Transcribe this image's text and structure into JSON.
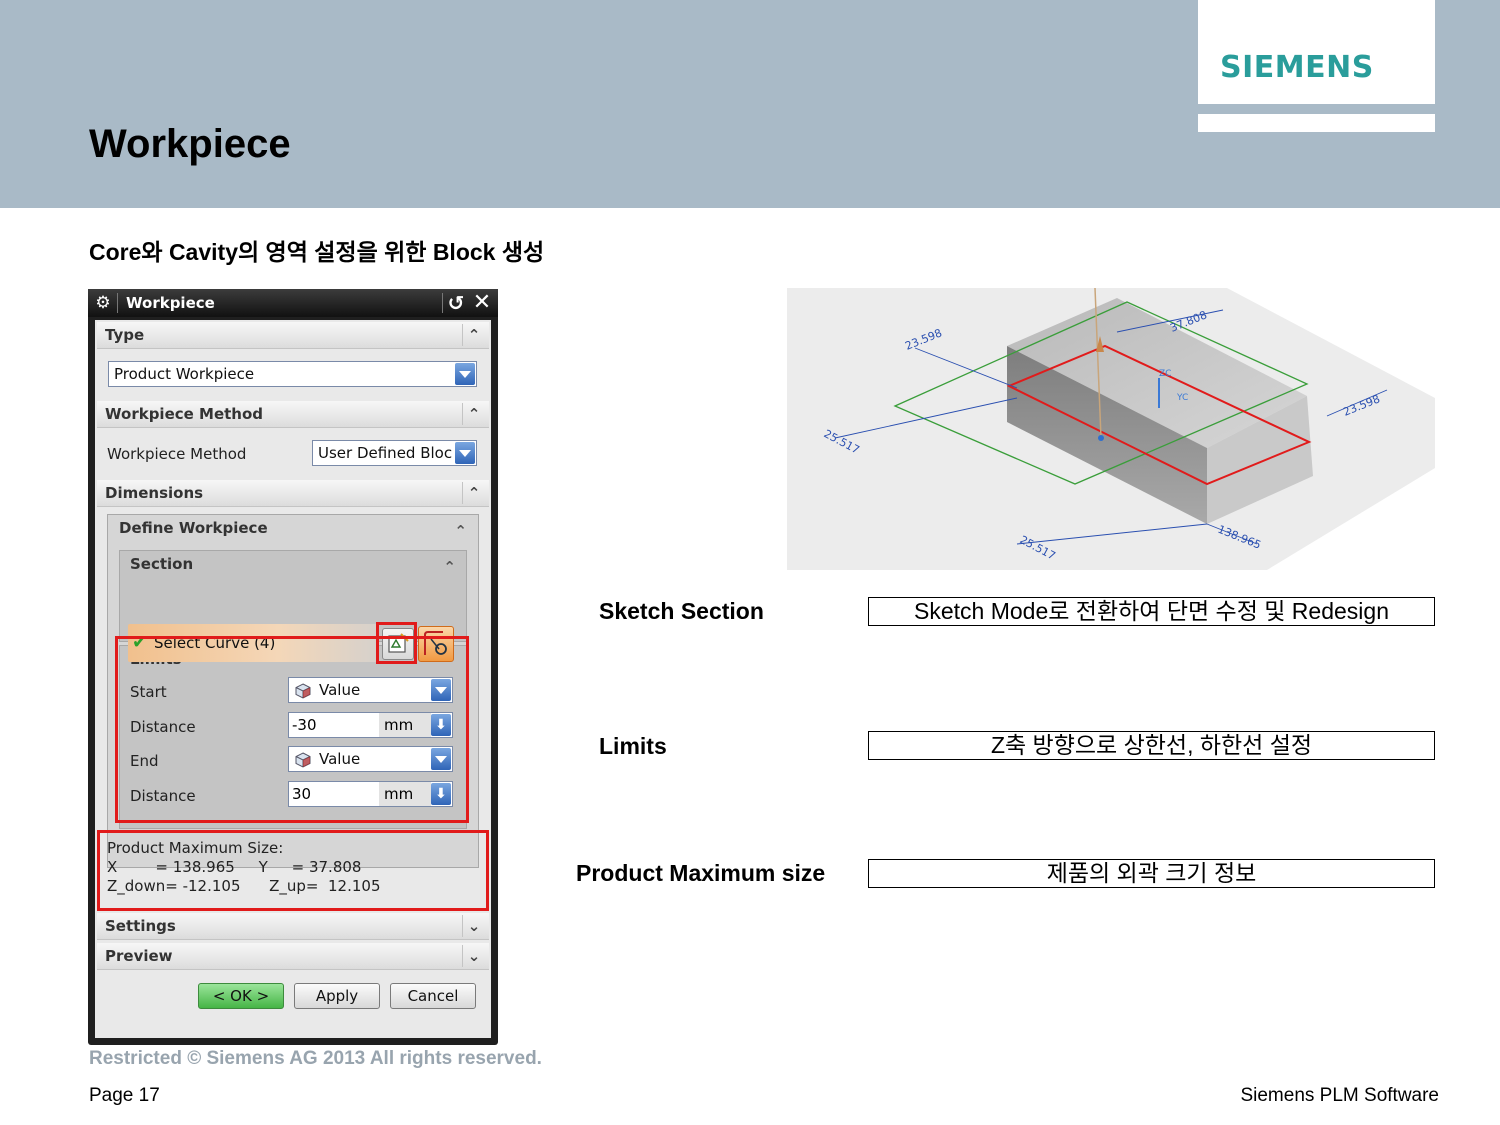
{
  "header": {
    "title": "Workpiece",
    "logo": "SIEMENS",
    "brand_color": "#2a9d9b",
    "band_color": "#a9bac7"
  },
  "subtitle": "Core와 Cavity의 영역 설정을 위한 Block 생성",
  "dialog": {
    "title": "Workpiece",
    "type_group": {
      "label": "Type",
      "selected": "Product Workpiece"
    },
    "method_group": {
      "label": "Workpiece Method",
      "row_label": "Workpiece Method",
      "selected": "User Defined Block"
    },
    "dimensions_group": {
      "label": "Dimensions"
    },
    "define_workpiece": {
      "label": "Define Workpiece"
    },
    "section": {
      "label": "Section",
      "select_curve": "Select Curve (4)"
    },
    "limits": {
      "label": "Limits",
      "start_label": "Start",
      "start_value": "Value",
      "distance1_label": "Distance",
      "distance1_value": "-30",
      "distance1_unit": "mm",
      "end_label": "End",
      "end_value": "Value",
      "distance2_label": "Distance",
      "distance2_value": "30",
      "distance2_unit": "mm"
    },
    "max_size": {
      "heading": "Product Maximum Size:",
      "line1": "X        = 138.965     Y     = 37.808",
      "line2": "Z_down= -12.105      Z_up=  12.105"
    },
    "settings_label": "Settings",
    "preview_label": "Preview",
    "ok_label": "< OK >",
    "apply_label": "Apply",
    "cancel_label": "Cancel"
  },
  "cad_view": {
    "dim_top_left": "23.598",
    "dim_top_right": "37.808",
    "dim_right": "23.598",
    "dim_left": "25.517",
    "dim_bottom_left": "25.517",
    "dim_bottom_right": "138.965",
    "axis_z": "ZC",
    "axis_y": "YC"
  },
  "annotations": [
    {
      "label": "Sketch Section",
      "description": "Sketch Mode로 전환하여 단면 수정 및 Redesign"
    },
    {
      "label": "Limits",
      "description": "Z축 방향으로 상한선, 하한선 설정"
    },
    {
      "label": "Product Maximum size",
      "description": "제품의 외곽 크기 정보"
    }
  ],
  "footer": {
    "copyright": "Restricted © Siemens AG 2013 All rights reserved.",
    "page": "Page 17",
    "company": "Siemens PLM Software"
  }
}
